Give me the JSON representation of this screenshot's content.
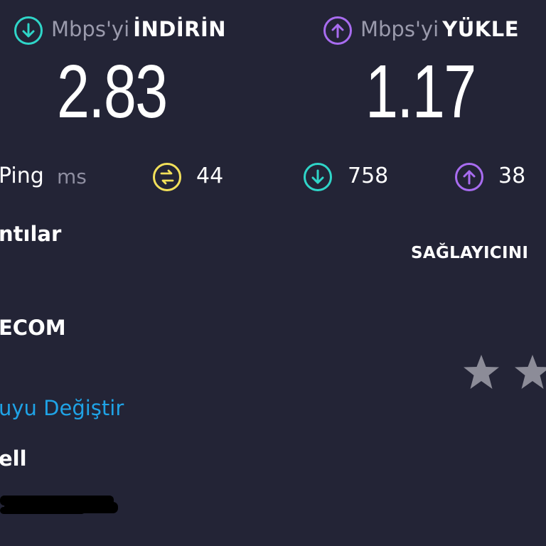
{
  "download": {
    "unit": "Mbps'yi",
    "label": "İNDİRİN",
    "value": "2.83",
    "icon": "arrow-down-circle-icon",
    "color": "#2fd5c8"
  },
  "upload": {
    "unit": "Mbps'yi",
    "label": "YÜKLE",
    "value": "1.17",
    "icon": "arrow-up-circle-icon",
    "color": "#a86cf0"
  },
  "ping": {
    "label": "Ping",
    "unit": "ms",
    "jitter_value": "44",
    "jitter_color": "#f2e05a",
    "download_latency": "758",
    "upload_latency": "38"
  },
  "connections": {
    "heading_partial": "ntılar",
    "provider_partial": "ECOM",
    "change_server_partial": "uyu Değiştir",
    "server_partial": "ell"
  },
  "rating": {
    "prompt_partial": "SAĞLAYICINI",
    "stars_visible": 2
  }
}
